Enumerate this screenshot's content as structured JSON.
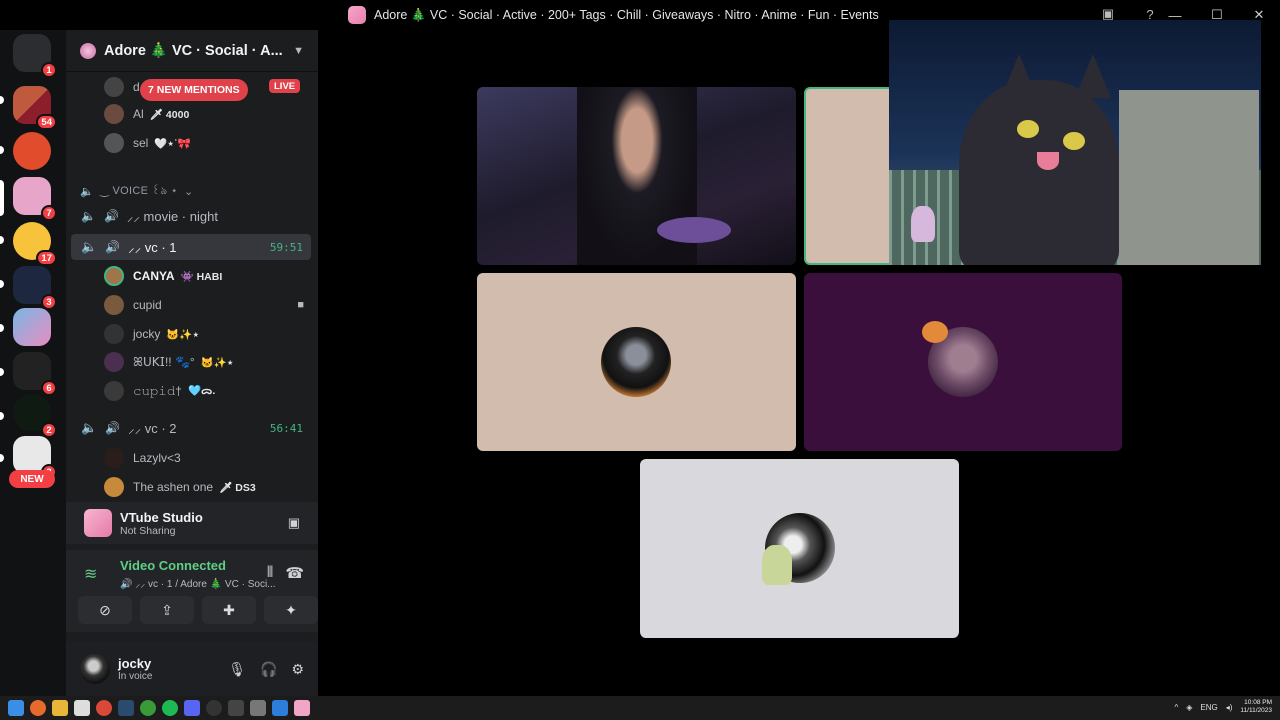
{
  "titlebar": {
    "title": "Adore 🎄 VC · Social · Active · 200+ Tags · Chill · Giveaways · Nitro · Anime · Fun · Events"
  },
  "rail": {
    "badges": [
      "1",
      "54",
      "7",
      "17",
      "3",
      "3",
      "6",
      "2",
      "3"
    ],
    "new_label": "NEW"
  },
  "guild": {
    "name": "Adore 🎄 VC · Social · A...",
    "mentions_label": "7 NEW MENTIONS",
    "live_label": "LIVE"
  },
  "top_members": [
    {
      "name": "d",
      "tag": ""
    },
    {
      "name": "Al",
      "tag": "🗡 4000"
    },
    {
      "name": "sel",
      "tag": "🤍⋆˙🎀"
    }
  ],
  "category": {
    "label": "‿ VOICE ꒰ঌ ⋆"
  },
  "channels": [
    {
      "name": "⸝⸝ movie · night",
      "time": ""
    },
    {
      "name": "⸝⸝ vc · 1",
      "time": "59:51"
    },
    {
      "name": "⸝⸝ vc · 2",
      "time": "56:41"
    }
  ],
  "vc1_members": [
    {
      "name": "CANYA",
      "tag": "👾 HABI"
    },
    {
      "name": "cupid",
      "tag": ""
    },
    {
      "name": "jocky",
      "tag": "🐱✨⋆"
    },
    {
      "name": "ꕤ𝖴𝖪𝖨!! 🐾°",
      "tag": "🐱✨⋆"
    },
    {
      "name": "𝚌𝚞𝚙𝚒𝚍†",
      "tag": "🩵ᯅ."
    }
  ],
  "vc2_members": [
    {
      "name": "Lazylv<3",
      "tag": ""
    },
    {
      "name": "The ashen one",
      "tag": "🗡 DS3"
    }
  ],
  "vtube": {
    "title": "VTube Studio",
    "subtitle": "Not Sharing"
  },
  "voice": {
    "status": "Video Connected",
    "location": "🔊 ⸝⸝ vc · 1 / Adore 🎄 VC · Soci..."
  },
  "user": {
    "name": "jocky",
    "status": "In voice"
  },
  "tray": {
    "lang": "ENG",
    "time": "10:08 PM",
    "date": "11/11/2023"
  },
  "colors": {
    "accent_green": "#43b581",
    "badge_red": "#f23f43",
    "tile_beige": "#d1bcad",
    "tile_purple": "#3a0f3b",
    "tile_gray": "#d9d8dd"
  }
}
